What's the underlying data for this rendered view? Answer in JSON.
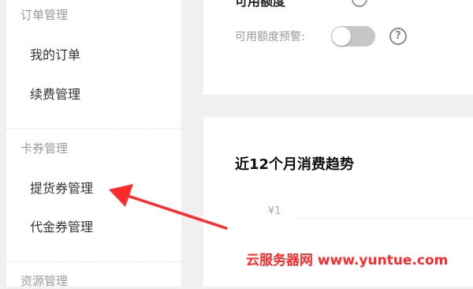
{
  "sidebar": {
    "sections": [
      {
        "title": "订单管理",
        "items": [
          "我的订单",
          "续费管理"
        ]
      },
      {
        "title": "卡券管理",
        "items": [
          "提货券管理",
          "代金券管理"
        ]
      },
      {
        "title": "资源管理",
        "items": []
      }
    ]
  },
  "settings": {
    "cutoff_label": "可用额度",
    "warning_label": "可用额度预警:",
    "warning_enabled": false,
    "help_glyph": "?"
  },
  "chart": {
    "title": "近12个月消费趋势",
    "y_tick": "¥1"
  },
  "chart_data": {
    "type": "line",
    "title": "近12个月消费趋势",
    "y_ticks": [
      "¥1"
    ]
  },
  "watermark": "云服务器网 www.yuntue.com",
  "colors": {
    "annotation_arrow": "#ff2a2a"
  }
}
